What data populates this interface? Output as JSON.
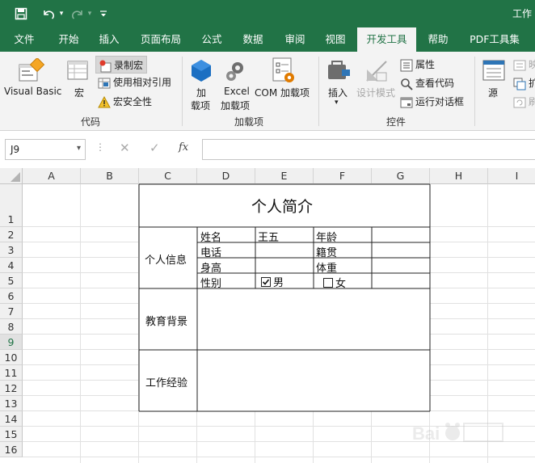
{
  "quick_access": {
    "save_icon": "save-icon",
    "undo_icon": "undo-icon",
    "redo_icon": "redo-icon",
    "customize_icon": "customize-icon"
  },
  "title": "工作",
  "tabs": [
    "文件",
    "开始",
    "插入",
    "页面布局",
    "公式",
    "数据",
    "审阅",
    "视图",
    "开发工具",
    "帮助",
    "PDF工具集"
  ],
  "active_tab": "开发工具",
  "ribbon": {
    "code": {
      "group_label": "代码",
      "visual_basic": "Visual Basic",
      "macros": "宏",
      "record_macro": "录制宏",
      "relative_ref": "使用相对引用",
      "macro_security": "宏安全性"
    },
    "addins": {
      "group_label": "加载项",
      "addins_l1": "加",
      "addins_l2": "载项",
      "excel_l1": "Excel",
      "excel_l2": "加载项",
      "com": "COM 加载项"
    },
    "controls": {
      "group_label": "控件",
      "insert": "插入",
      "design_mode": "设计模式",
      "properties": "属性",
      "view_code": "查看代码",
      "run_dialog": "运行对话框"
    },
    "xml": {
      "source": "源",
      "cut1": "映",
      "cut2": "扩",
      "cut3": "刷"
    }
  },
  "formula_bar": {
    "name_box": "J9",
    "cancel": "✕",
    "enter": "✓",
    "fx": "fx",
    "value": ""
  },
  "sheet": {
    "columns": [
      "A",
      "B",
      "C",
      "D",
      "E",
      "F",
      "G",
      "H",
      "I"
    ],
    "rows": [
      "1",
      "2",
      "3",
      "4",
      "5",
      "6",
      "7",
      "8",
      "9",
      "10",
      "11",
      "12",
      "13",
      "14",
      "15",
      "16"
    ],
    "active_row": "9",
    "resume": {
      "title": "个人简介",
      "section_personal": "个人信息",
      "section_education": "教育背景",
      "section_work": "工作经验",
      "name_label": "姓名",
      "name_value": "王五",
      "age_label": "年龄",
      "phone_label": "电话",
      "hometown_label": "籍贯",
      "height_label": "身高",
      "weight_label": "体重",
      "gender_label": "性别",
      "male_label": "男",
      "female_label": "女",
      "male_checked": true,
      "female_checked": false
    }
  },
  "colors": {
    "brand": "#217346",
    "ribbon_bg": "#f3f3f3"
  }
}
